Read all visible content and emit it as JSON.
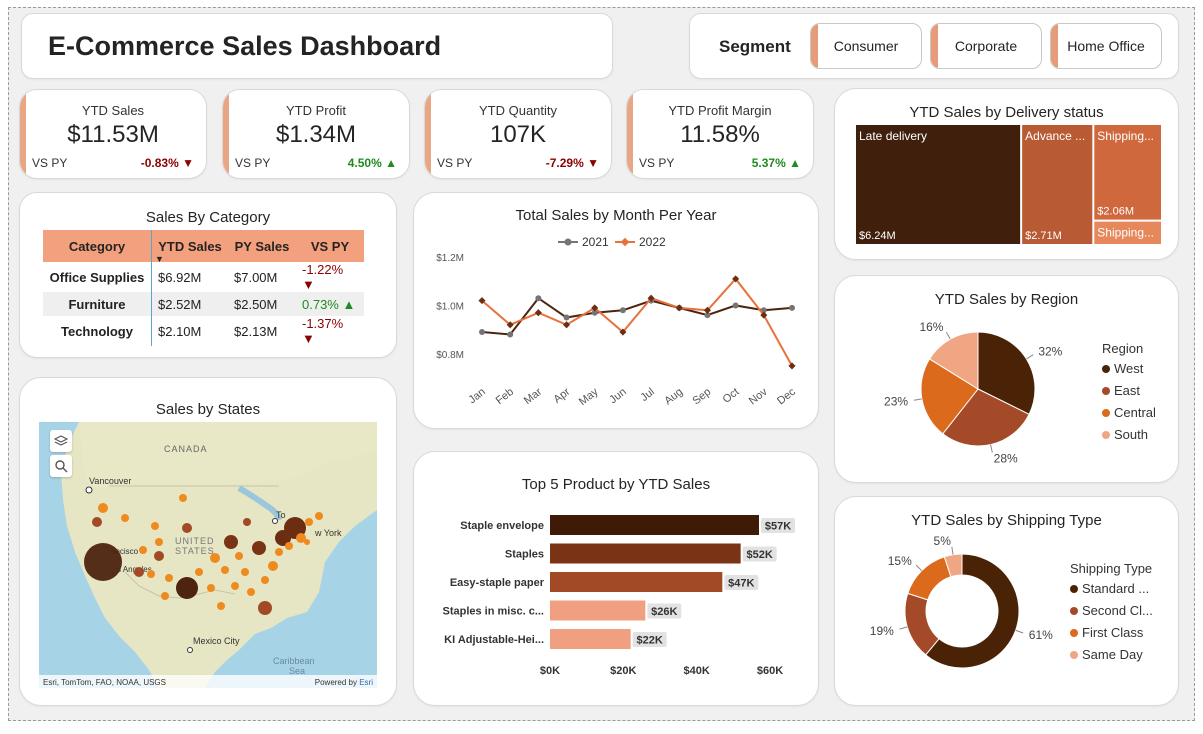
{
  "header": {
    "title": "E-Commerce Sales Dashboard"
  },
  "segment": {
    "label": "Segment",
    "options": [
      "Consumer",
      "Corporate",
      "Home Office"
    ]
  },
  "kpis": [
    {
      "label": "YTD Sales",
      "value": "$11.53M",
      "vs": "VS PY",
      "change": "-0.83%",
      "arrow": "▼",
      "direction": "down"
    },
    {
      "label": "YTD Profit",
      "value": "$1.34M",
      "vs": "VS PY",
      "change": "4.50%",
      "arrow": "▲",
      "direction": "up"
    },
    {
      "label": "YTD Quantity",
      "value": "107K",
      "vs": "VS PY",
      "change": "-7.29%",
      "arrow": "▼",
      "direction": "down"
    },
    {
      "label": "YTD Profit Margin",
      "value": "11.58%",
      "vs": "VS PY",
      "change": "5.37%",
      "arrow": "▲",
      "direction": "up"
    }
  ],
  "category_table": {
    "title": "Sales By Category",
    "headers": [
      "Category",
      "YTD Sales",
      "PY Sales",
      "VS PY"
    ],
    "sort_icon": "▼",
    "rows": [
      {
        "category": "Office Supplies",
        "ytd": "$6.92M",
        "py": "$7.00M",
        "vs": "-1.22%",
        "arrow": "▼",
        "direction": "down"
      },
      {
        "category": "Furniture",
        "ytd": "$2.52M",
        "py": "$2.50M",
        "vs": "0.73%",
        "arrow": "▲",
        "direction": "up"
      },
      {
        "category": "Technology",
        "ytd": "$2.10M",
        "py": "$2.13M",
        "vs": "-1.37%",
        "arrow": "▼",
        "direction": "down"
      }
    ]
  },
  "map": {
    "title": "Sales by States",
    "labels": {
      "canada": "CANADA",
      "vancouver": "Vancouver",
      "united": "UNITED",
      "states": "STATES",
      "toronto": "To",
      "newyork": "w York",
      "mexico": "Mexico City",
      "caribbean": "Caribbean",
      "sea": "Sea",
      "sf": "ancisco",
      "la": "s Angeles"
    },
    "attribution": "Esri, TomTom, FAO, NOAA, USGS",
    "powered_prefix": "Powered by ",
    "powered_brand": "Esri",
    "icons": [
      "layers-icon",
      "search-icon"
    ]
  },
  "line_chart_title": "Total Sales by Month Per Year",
  "bar_chart_title": "Top 5 Product by YTD Sales",
  "delivery_title": "YTD Sales by Delivery status",
  "region_title": "YTD Sales by Region",
  "shipping_title": "YTD Sales by Shipping Type",
  "chart_data": [
    {
      "type": "line",
      "title": "Total Sales by Month Per Year",
      "x": [
        "Jan",
        "Feb",
        "Mar",
        "Apr",
        "May",
        "Jun",
        "Jul",
        "Aug",
        "Sep",
        "Oct",
        "Nov",
        "Dec"
      ],
      "yticks": [
        "$0.8M",
        "$1.0M",
        "$1.2M"
      ],
      "ylim": [
        0.7,
        1.25
      ],
      "series": [
        {
          "name": "2021",
          "color": "#757575",
          "values": [
            0.89,
            0.88,
            1.03,
            0.95,
            0.97,
            0.98,
            1.02,
            0.99,
            0.96,
            1.0,
            0.98,
            0.99
          ]
        },
        {
          "name": "2022",
          "color": "#e8713c",
          "values": [
            1.02,
            0.92,
            0.97,
            0.92,
            0.99,
            0.89,
            1.03,
            0.99,
            0.98,
            1.11,
            0.96,
            0.75
          ]
        }
      ],
      "legend": "top-center",
      "grid": false
    },
    {
      "type": "bar",
      "orientation": "horizontal",
      "title": "Top 5 Product by YTD Sales",
      "categories": [
        "Staple envelope",
        "Staples",
        "Easy-staple paper",
        "Staples in misc. c...",
        "KI Adjustable-Hei..."
      ],
      "values": [
        57,
        52,
        47,
        26,
        22
      ],
      "labels": [
        "$57K",
        "$52K",
        "$47K",
        "$26K",
        "$22K"
      ],
      "colors": [
        "#3e1a07",
        "#7a3415",
        "#a24a25",
        "#f0a080",
        "#f0a080"
      ],
      "xticks": [
        "$0K",
        "$20K",
        "$40K",
        "$60K"
      ],
      "xlim": [
        0,
        60
      ]
    },
    {
      "type": "treemap",
      "title": "YTD Sales by Delivery status",
      "items": [
        {
          "name": "Late delivery",
          "label": "$6.24M",
          "value": 6.24,
          "color": "#40200d"
        },
        {
          "name": "Advance ...",
          "label": "$2.71M",
          "value": 2.71,
          "color": "#b85a33"
        },
        {
          "name": "Shipping...",
          "label": "$2.06M",
          "value": 2.06,
          "color": "#d0683d"
        },
        {
          "name": "Shipping...",
          "label": "",
          "value": 0.52,
          "color": "#e7875c"
        }
      ]
    },
    {
      "type": "pie",
      "title": "YTD Sales by Region",
      "legend_title": "Region",
      "labels": [
        "West",
        "East",
        "Central",
        "South"
      ],
      "values": [
        32,
        28,
        23,
        16
      ],
      "display": [
        "32%",
        "28%",
        "23%",
        "16%"
      ],
      "colors": [
        "#4a2307",
        "#a54a28",
        "#db6a1c",
        "#f0a583"
      ],
      "legend": "right"
    },
    {
      "type": "pie",
      "donut": true,
      "title": "YTD Sales by Shipping Type",
      "legend_title": "Shipping Type",
      "labels": [
        "Standard ...",
        "Second Cl...",
        "First Class",
        "Same Day"
      ],
      "values": [
        61,
        19,
        15,
        5
      ],
      "display": [
        "61%",
        "19%",
        "15%",
        "5%"
      ],
      "colors": [
        "#4a2307",
        "#a54a28",
        "#db6a1c",
        "#f0a583"
      ],
      "legend": "right"
    }
  ]
}
